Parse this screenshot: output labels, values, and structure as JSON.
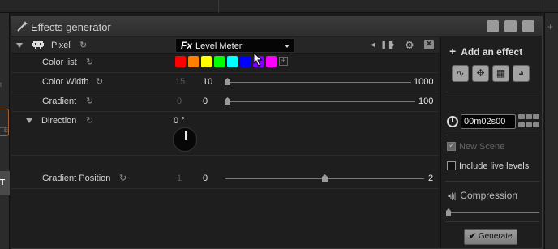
{
  "window": {
    "title": "Effects generator"
  },
  "header": {
    "fixture_name": "Pixel",
    "effect_name": "Level Meter",
    "fx_glyph": "Fx"
  },
  "rows": {
    "color_list": {
      "label": "Color list",
      "colors": [
        "#ff0000",
        "#ff8000",
        "#ffff00",
        "#00ff00",
        "#00ffff",
        "#0000ff",
        "#8000ff",
        "#ff00ff"
      ]
    },
    "color_width": {
      "label": "Color Width",
      "min": "15",
      "value": "10",
      "max": "1000"
    },
    "gradient": {
      "label": "Gradient",
      "min": "0",
      "value": "0",
      "max": "100"
    },
    "direction": {
      "label": "Direction",
      "value": "0 °"
    },
    "gradient_position": {
      "label": "Gradient Position",
      "min": "1",
      "value": "0",
      "max": "2"
    }
  },
  "sidebar": {
    "add_effect": "Add an effect",
    "time": "00m02s00",
    "new_scene": {
      "label": "New Scene",
      "checked": true,
      "enabled": false
    },
    "include_live": {
      "label": "Include live levels",
      "checked": false
    },
    "compression": "Compression",
    "generate": "Generate"
  },
  "left_edge": {
    "text_a": "t",
    "text_b": "TE",
    "text_c": "T"
  }
}
